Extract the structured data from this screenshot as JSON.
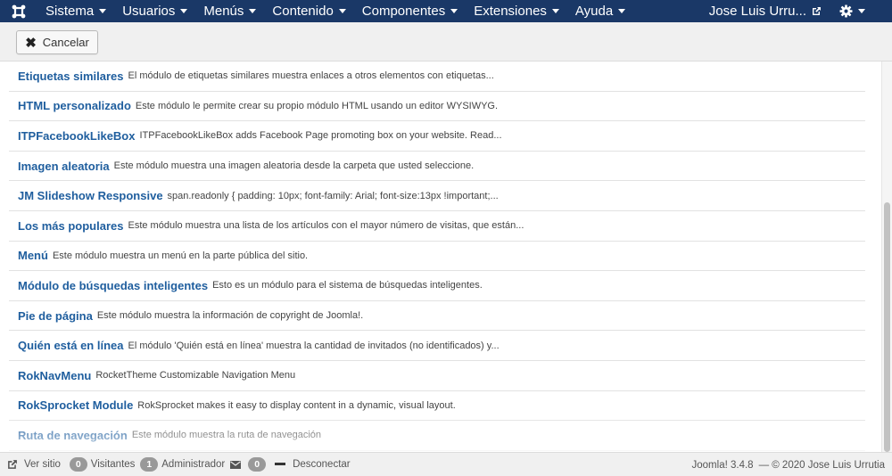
{
  "navbar": {
    "menu": [
      {
        "label": "Sistema"
      },
      {
        "label": "Usuarios"
      },
      {
        "label": "Menús"
      },
      {
        "label": "Contenido"
      },
      {
        "label": "Componentes"
      },
      {
        "label": "Extensiones"
      },
      {
        "label": "Ayuda"
      }
    ],
    "user_label": "Jose Luis Urru...",
    "logo_icon": "joomla-logo-icon",
    "settings_icon": "gear-icon",
    "bg_color": "#1a3867"
  },
  "toolbar": {
    "cancel_label": "Cancelar",
    "cancel_icon": "close-icon"
  },
  "modules": [
    {
      "title": "Etiquetas similares",
      "desc": "El módulo de etiquetas similares muestra enlaces a otros elementos con etiquetas..."
    },
    {
      "title": "HTML personalizado",
      "desc": "Este módulo le permite crear su propio módulo HTML usando un editor WYSIWYG."
    },
    {
      "title": "ITPFacebookLikeBox",
      "desc": "ITPFacebookLikeBox adds Facebook Page promoting box on your website. Read..."
    },
    {
      "title": "Imagen aleatoria",
      "desc": "Este módulo muestra una imagen aleatoria desde la carpeta que usted seleccione."
    },
    {
      "title": "JM Slideshow Responsive",
      "desc": "span.readonly { padding: 10px; font-family: Arial; font-size:13px !important;..."
    },
    {
      "title": "Los más populares",
      "desc": "Este módulo muestra una lista de los artículos con el mayor número de visitas, que están..."
    },
    {
      "title": "Menú",
      "desc": "Este módulo muestra un menú en la parte pública del sitio."
    },
    {
      "title": "Módulo de búsquedas inteligentes",
      "desc": "Esto es un módulo para el sistema de búsquedas inteligentes."
    },
    {
      "title": "Pie de página",
      "desc": "Este módulo muestra la información de copyright de Joomla!."
    },
    {
      "title": "Quién está en línea",
      "desc": "El módulo 'Quién está en línea' muestra la cantidad de invitados (no identificados) y..."
    },
    {
      "title": "RokNavMenu",
      "desc": "RocketTheme Customizable Navigation Menu"
    },
    {
      "title": "RokSprocket Module",
      "desc": "RokSprocket makes it easy to display content in a dynamic, visual layout."
    },
    {
      "title": "Ruta de navegación",
      "desc": "Este módulo muestra la ruta de navegación"
    }
  ],
  "statusbar": {
    "view_site": "Ver sitio",
    "visitors_count": "0",
    "visitors_label": "Visitantes",
    "admins_count": "1",
    "admins_label": "Administrador",
    "messages_count": "0",
    "logout_label": "Desconectar",
    "version": "Joomla! 3.4.8",
    "copyright": "— © 2020 Jose Luis Urrutia"
  },
  "colors": {
    "link": "#1f5e9e",
    "badge": "#999999"
  }
}
